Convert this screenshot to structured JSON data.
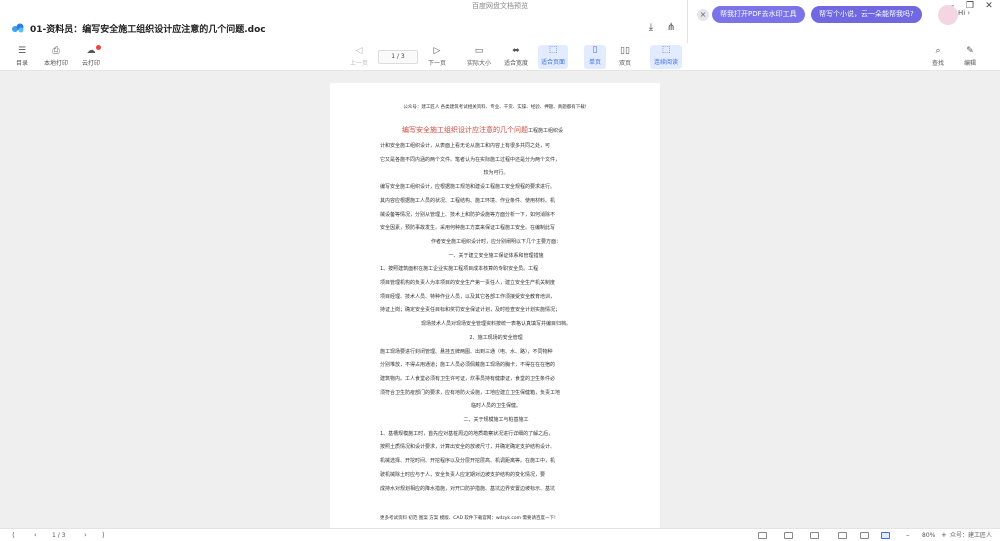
{
  "window": {
    "title": "百度网盘文档预览",
    "minimize": "–",
    "restore": "❐",
    "close": "✕"
  },
  "header": {
    "doc_title": "01-资料员：编写安全施工组织设计应注意的几个问题.doc",
    "ai_close": "×",
    "ai_pills": [
      "帮我打开PDF去水印工具",
      "帮写个小说，云一朵能帮我吗?"
    ],
    "greeting": "Hi ›"
  },
  "toolbar": {
    "catalog": "目录",
    "local_print": "本地打印",
    "cloud_print": "云打印",
    "prev_page": "上一页",
    "page_indicator": "1 / 3",
    "next_page": "下一页",
    "actual_size": "实际大小",
    "fit_width": "适合宽度",
    "fit_page": "适合页面",
    "single_page": "单页",
    "double_page": "双页",
    "continuous": "连续阅读",
    "search": "查找",
    "edit": "编辑"
  },
  "document": {
    "header_line": "公众号：建工匠人  各类建筑考试相关资料、专业、干货、实操、经验、押题、真题都有下载!",
    "title": "编写安全施工组织设计应注意的几个问题",
    "title_suffix": "工程施工组织设",
    "lines": [
      "计和安全施工组织设计，从表面上看无论从施工和内容上有很多共同之处，可",
      "它又是各施不同内涵的两个文件。笔者认为在实际施工过程中还是分为两个文件，",
      "较为可行。",
      "编写安全施工组织设计，应根据施工规范和建设工程施工安全规程的要求进行。",
      "其内容应根据施工人员的状况、工程结构、施工环境、作业条件、使用材料、机",
      "械设备等情况，分别从管理上、技术上和防护设施等方面分析一下，如何消除不",
      "安全因素，预防事故发生。采用何种施工方案来保证工程施工安全。在编制此写",
      "作者安全施工组织设计时，应分别阐明以下几个主要方面：",
      "一、关于建立安全施工保证体系和管理措施",
      "1、按照建筑面积在施工企业实施工程项目成本核算的专职安全员。工程",
      "项目管理机构的负责人为本项目的安全生产第一责任人，建立安全生产机关制度",
      "项目经理、技术人员、特种作业人员，以及其它各部工作须接受安全教育培训，",
      "持证上岗；确定安全责任目标和奖罚安全保证计划，及时检查安全计划实施情况；",
      "现场技术人员对现场安全管理资料按统一表格认真填写并编目归档。",
      "2、施工现场的安全管理",
      "施工现场要进行封闭管理、悬挂五牌两图、出到三通（电、水、路），不同物种",
      "分别堆放，不得占用通道；施工人员必须佩戴施工现场的胸卡，不得在在在宿的",
      "建筑物内。工人食堂必须有卫生许可证，炊事员持有健康证，食堂的卫生条件必",
      "须符合卫生防疫部门的要求，应有地防火设施，工地应建立卫生保健箱，负责工地",
      "临时人员的卫生保健。",
      "二、关于规模施工与桩基施工",
      "1、基槽规模施工时，首先应对基桩周边的地质勘察状况进行详细的了解之后，",
      "按照土质情况和设计要求，计算出安全的放坡尺寸，并确定确定支护结构设计、",
      "机械选择、开挖时间、开挖程序以及分层开挖层高、机调距离等。在施工中，机",
      "驶机械除土时应与于人，安全负责人应定期对边坡支护结构的变化情况，要",
      "成持水对规划相应的降水措施，对开口防护措施、基坑边界安置边坡标示、基坑"
    ],
    "footer": "更多考试资料 初范  图案  方案  模版、CAD 软件下载官网：wdzyk.com  需要请百度一下!"
  },
  "statusbar": {
    "first": "⟨",
    "prev": "‹",
    "page_indicator": "1 / 3",
    "next": "›",
    "last": "⟩",
    "zoom_out": "–",
    "zoom": "80%",
    "zoom_in": "+",
    "watermark": "众号：建工匠人"
  },
  "colors": {
    "accent": "#3b6fe8",
    "title_red": "#d04a3a",
    "ai_pill": "#7b74e8",
    "background": "#efefef"
  },
  "icons": [
    "logo-cloud-icon",
    "download-icon",
    "share-icon",
    "catalog-icon",
    "printer-icon",
    "cloud-print-icon",
    "prev-icon",
    "next-icon",
    "actual-size-icon",
    "fit-width-icon",
    "fit-page-icon",
    "single-page-icon",
    "double-page-icon",
    "continuous-icon",
    "search-icon",
    "edit-icon"
  ]
}
